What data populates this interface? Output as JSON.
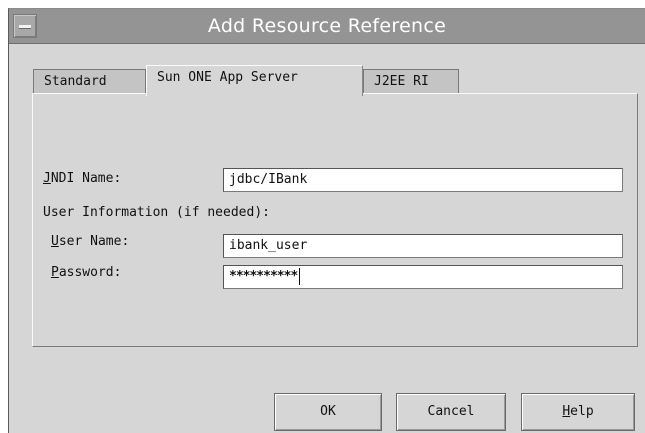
{
  "window": {
    "title": "Add Resource Reference"
  },
  "tabs": [
    {
      "label": "Standard"
    },
    {
      "label": "Sun ONE App Server"
    },
    {
      "label": "J2EE RI"
    }
  ],
  "form": {
    "jndi_label": "NDI Name:",
    "jndi_mnemonic": "J",
    "jndi_value": "jdbc/IBank",
    "user_info_label": "User Information (if needed):",
    "user_name_label_rest": "ser Name:",
    "user_name_mnemonic": "U",
    "user_name_value": "ibank_user",
    "password_label_rest": "assword:",
    "password_mnemonic": "P",
    "password_value": "**********"
  },
  "buttons": {
    "ok": "OK",
    "cancel": "Cancel",
    "help_mnemonic": "H",
    "help_rest": "elp"
  }
}
